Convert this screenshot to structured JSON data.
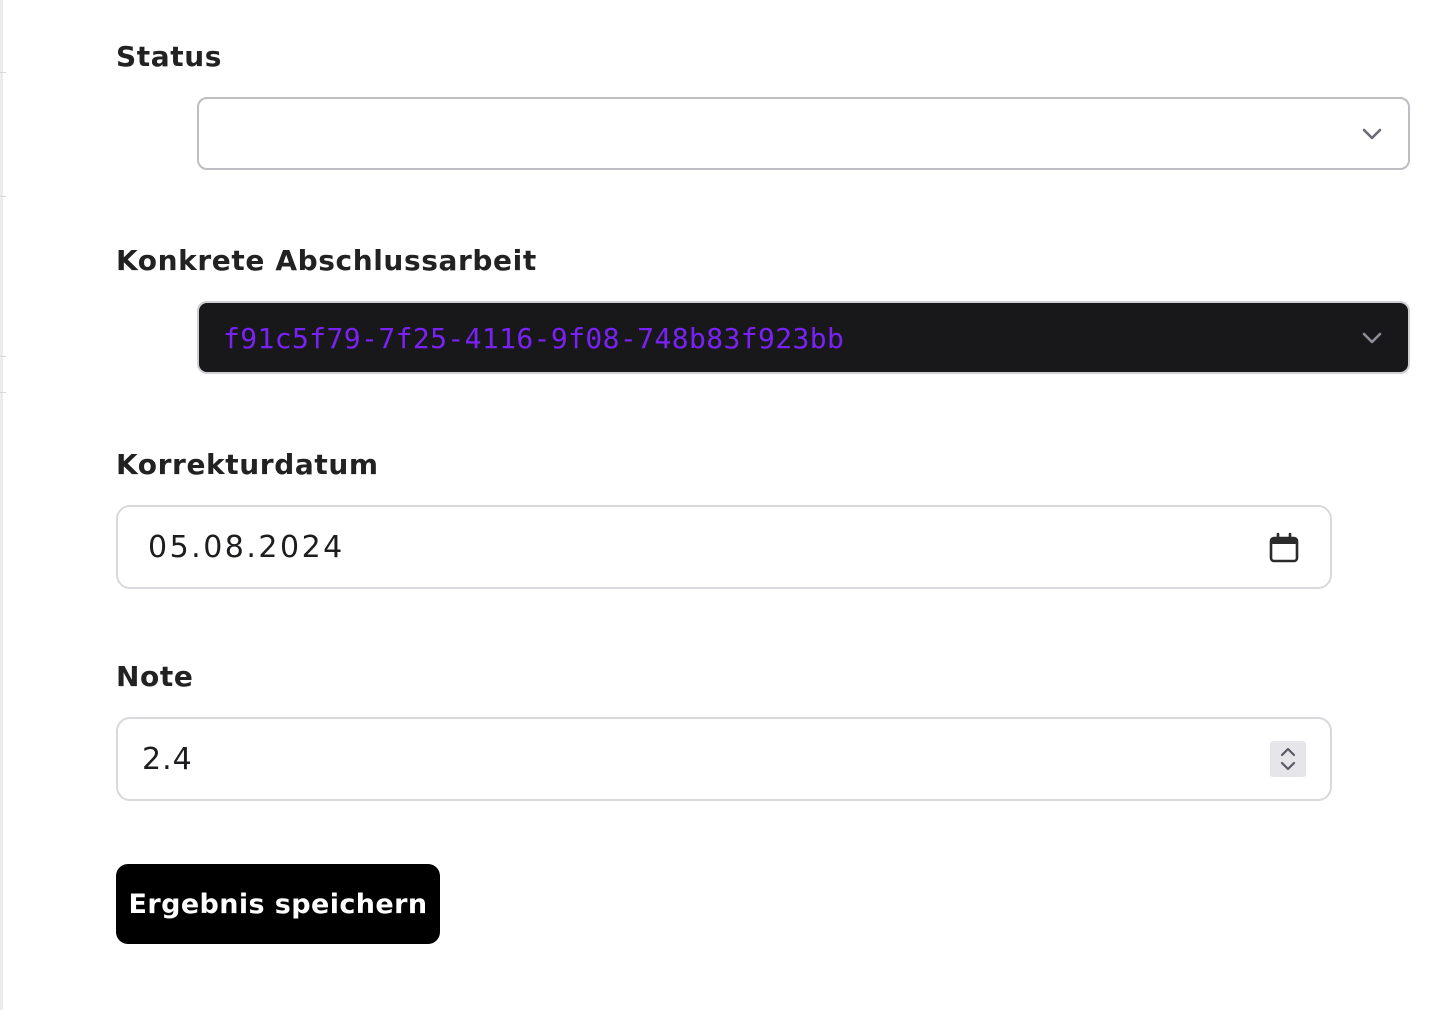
{
  "form": {
    "status": {
      "label": "Status",
      "selected_value": ""
    },
    "thesis": {
      "label": "Konkrete Abschlussarbeit",
      "selected_value": "f91c5f79-7f25-4116-9f08-748b83f923bb",
      "value_color": "#7a22f5",
      "background_color": "#18181a"
    },
    "correction_date": {
      "label": "Korrekturdatum",
      "value": "05.08.2024",
      "icon": "calendar-icon"
    },
    "grade": {
      "label": "Note",
      "value": "2.4",
      "icon": "spinner-arrows-icon"
    },
    "submit": {
      "label": "Ergebnis speichern"
    }
  },
  "colors": {
    "text": "#222222",
    "button_background": "#000000",
    "button_text": "#ffffff",
    "input_border": "#d9d9dd"
  }
}
